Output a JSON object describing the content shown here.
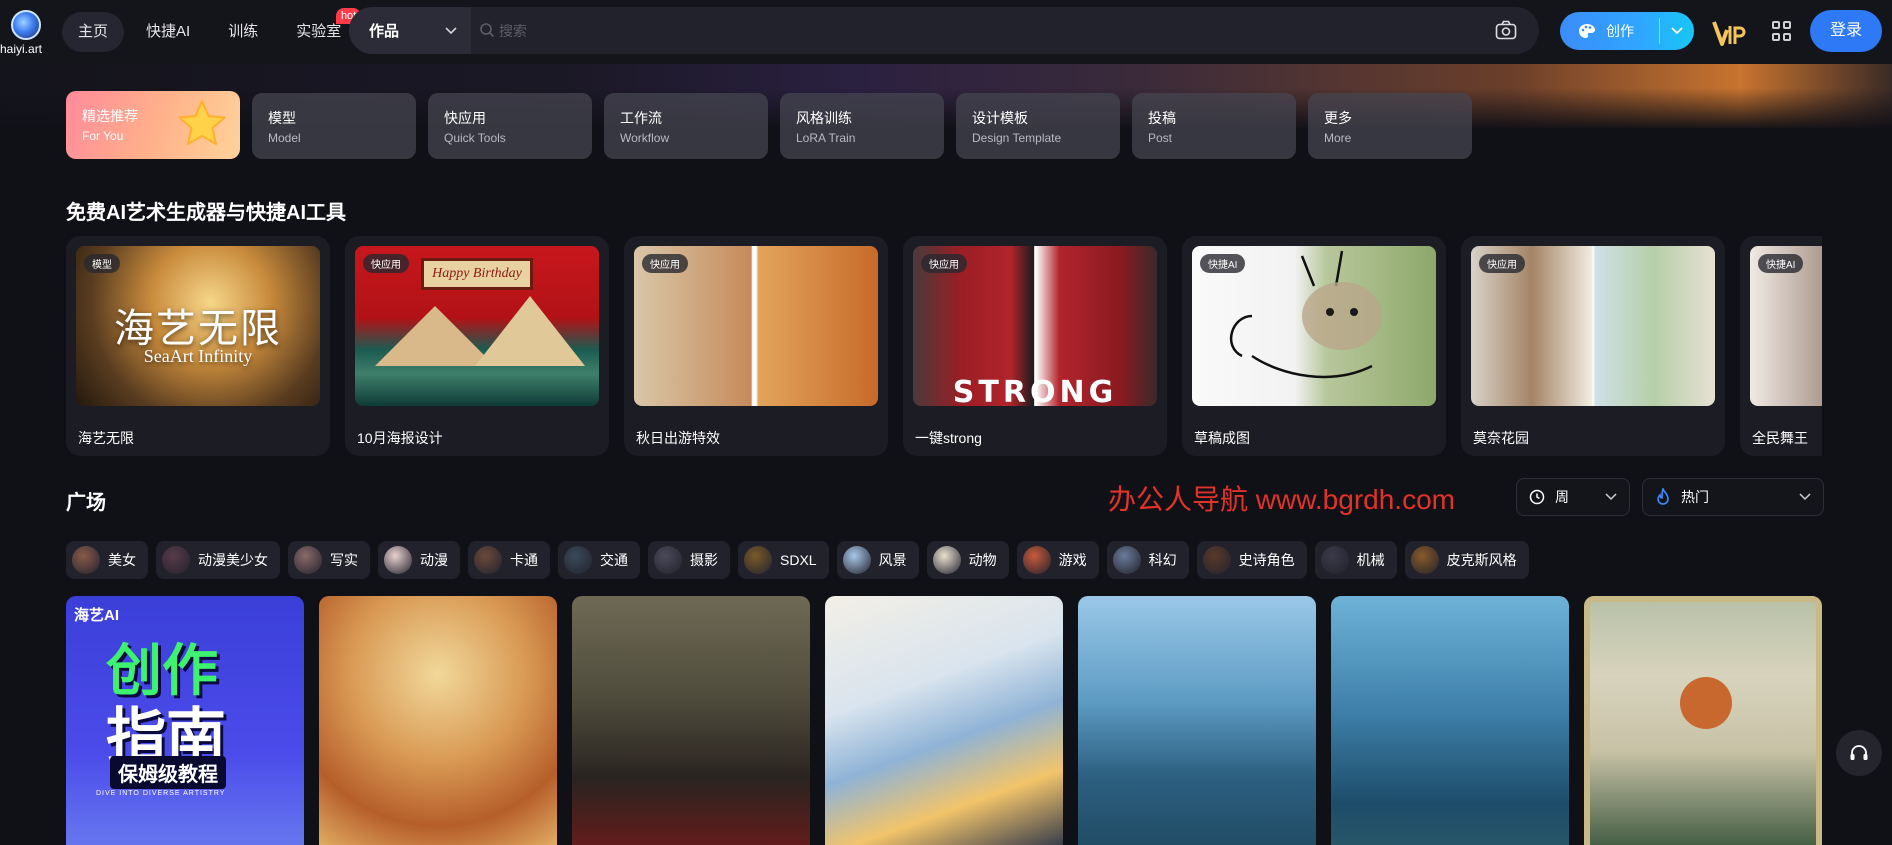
{
  "app": {
    "logo_text": "haiyi.art"
  },
  "nav": {
    "items": [
      {
        "label": "主页",
        "active": true
      },
      {
        "label": "快捷AI"
      },
      {
        "label": "训练"
      },
      {
        "label": "实验室",
        "badge": "hot"
      }
    ]
  },
  "search": {
    "category": "作品",
    "placeholder": "搜索"
  },
  "header": {
    "create_label": "创作",
    "login_label": "登录"
  },
  "categories": [
    {
      "title": "精选推荐",
      "subtitle": "For You"
    },
    {
      "title": "模型",
      "subtitle": "Model"
    },
    {
      "title": "快应用",
      "subtitle": "Quick Tools"
    },
    {
      "title": "工作流",
      "subtitle": "Workflow"
    },
    {
      "title": "风格训练",
      "subtitle": "LoRA Train"
    },
    {
      "title": "设计模板",
      "subtitle": "Design Template"
    },
    {
      "title": "投稿",
      "subtitle": "Post"
    },
    {
      "title": "更多",
      "subtitle": "More"
    }
  ],
  "tools_section": {
    "title": "免费AI艺术生成器与快捷AI工具",
    "cards": [
      {
        "tag": "模型",
        "name": "海艺无限",
        "overlay_cn": "海艺无限",
        "overlay_en": "SeaArt Infinity"
      },
      {
        "tag": "快应用",
        "name": "10月海报设计",
        "overlay_en": "Happy Birthday"
      },
      {
        "tag": "快应用",
        "name": "秋日出游特效"
      },
      {
        "tag": "快应用",
        "name": "一键strong",
        "overlay_en": "STRONG"
      },
      {
        "tag": "快捷AI",
        "name": "草稿成图"
      },
      {
        "tag": "快应用",
        "name": "莫奈花园"
      },
      {
        "tag": "快捷AI",
        "name": "全民舞王"
      }
    ]
  },
  "plaza": {
    "title": "广场",
    "watermark": "办公人导航 www.bgrdh.com",
    "filters": {
      "period": "周",
      "sort": "热门"
    },
    "tags": [
      "美女",
      "动漫美少女",
      "写实",
      "动漫",
      "卡通",
      "交通",
      "摄影",
      "SDXL",
      "风景",
      "动物",
      "游戏",
      "科幻",
      "史诗角色",
      "机械",
      "皮克斯风格"
    ],
    "tag_colors": [
      "#8a5a4a",
      "#5a3a4a",
      "#8a6a6a",
      "#e8d0d0",
      "#6a4a3a",
      "#3a4a5a",
      "#4a4a5a",
      "#7a5a2a",
      "#a8c8e8",
      "#e8e0d0",
      "#c85a3a",
      "#6a7a9a",
      "#5a3a2a",
      "#3a3a4a",
      "#8a5a2a"
    ],
    "guide_card": {
      "brand": "海艺AI",
      "line1": "创作",
      "line2": "指南",
      "line3": "保姆级教程",
      "line4": "DIVE INTO DIVERSE ARTISTRY"
    }
  },
  "colors": {
    "accent": "#2d79f6",
    "create_gradient_start": "#3b8cf8",
    "hot_badge": "#ff3b4a"
  }
}
